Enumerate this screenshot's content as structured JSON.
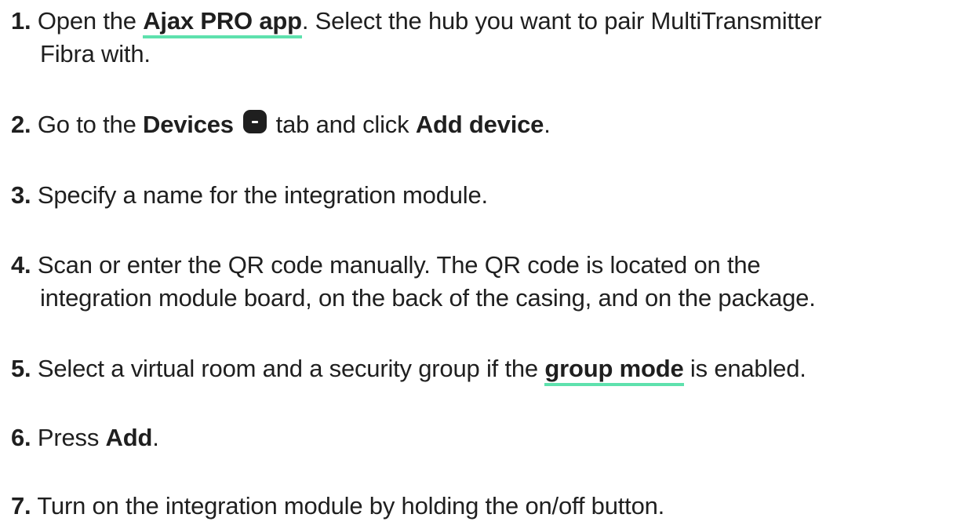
{
  "steps": [
    {
      "num": "1.",
      "pre": "Open the ",
      "link": "Ajax PRO app",
      "post": ". Select the hub you want to pair MultiTransmitter",
      "line2": "Fibra with."
    },
    {
      "num": "2.",
      "pre": "Go to the ",
      "bold1": "Devices",
      "icon": "devices-icon",
      "mid": " tab and click ",
      "bold2": "Add device",
      "post": "."
    },
    {
      "num": "3.",
      "text": "Specify a name for the integration module."
    },
    {
      "num": "4.",
      "text": "Scan or enter the QR code manually. The QR code is located on the",
      "line2": "integration module board, on the back of the casing, and on the package."
    },
    {
      "num": "5.",
      "pre": "Select a virtual room and a security group if the ",
      "link": "group mode",
      "post": " is enabled."
    },
    {
      "num": "6.",
      "pre": "Press ",
      "bold": "Add",
      "post": "."
    },
    {
      "num": "7.",
      "text": "Turn on the integration module by holding the on/off button."
    }
  ],
  "colors": {
    "text": "#1f1f1f",
    "link_underline": "#5ee1ad"
  }
}
